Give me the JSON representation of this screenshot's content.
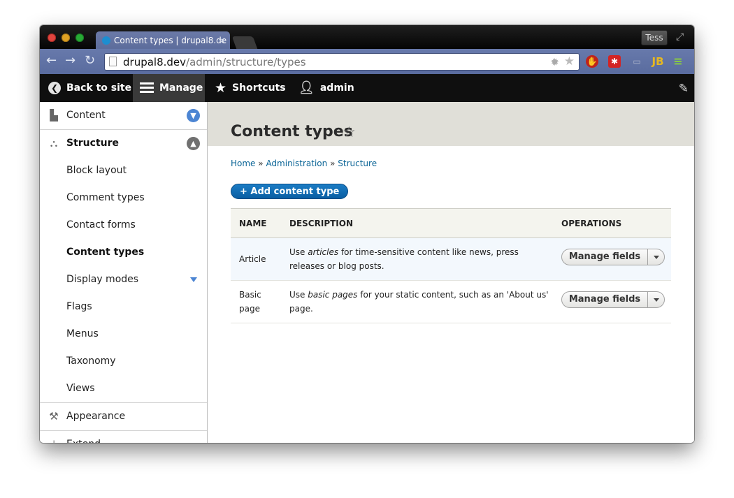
{
  "browser": {
    "tab_title": "Content types | drupal8.de",
    "tab_close": "×",
    "profile": "Tess",
    "url_host": "drupal8.dev",
    "url_path": "/admin/structure/types"
  },
  "toolbar": {
    "back_label": "Back to site",
    "manage_label": "Manage",
    "shortcuts_label": "Shortcuts",
    "user_label": "admin"
  },
  "sidebar": {
    "items": [
      {
        "label": "Content"
      },
      {
        "label": "Structure"
      },
      {
        "label": "Block layout"
      },
      {
        "label": "Comment types"
      },
      {
        "label": "Contact forms"
      },
      {
        "label": "Content types"
      },
      {
        "label": "Display modes"
      },
      {
        "label": "Flags"
      },
      {
        "label": "Menus"
      },
      {
        "label": "Taxonomy"
      },
      {
        "label": "Views"
      },
      {
        "label": "Appearance"
      },
      {
        "label": "Extend"
      }
    ]
  },
  "main": {
    "title": "Content types",
    "breadcrumb": [
      "Home",
      "Administration",
      "Structure"
    ],
    "breadcrumb_sep": "»",
    "add_button": "+ Add content type",
    "table": {
      "headers": [
        "NAME",
        "DESCRIPTION",
        "OPERATIONS"
      ],
      "rows": [
        {
          "name": "Article",
          "desc_pre": "Use ",
          "desc_em": "articles",
          "desc_post": " for time-sensitive content like news, press releases or blog posts.",
          "op": "Manage fields"
        },
        {
          "name": "Basic page",
          "desc_pre": "Use ",
          "desc_em": "basic pages",
          "desc_post": " for your static content, such as an 'About us' page.",
          "op": "Manage fields"
        }
      ]
    }
  },
  "colors": {
    "accent": "#0a6496",
    "toolbar_bg": "#0f0f0f",
    "toggle_blue": "#4c85d3"
  }
}
